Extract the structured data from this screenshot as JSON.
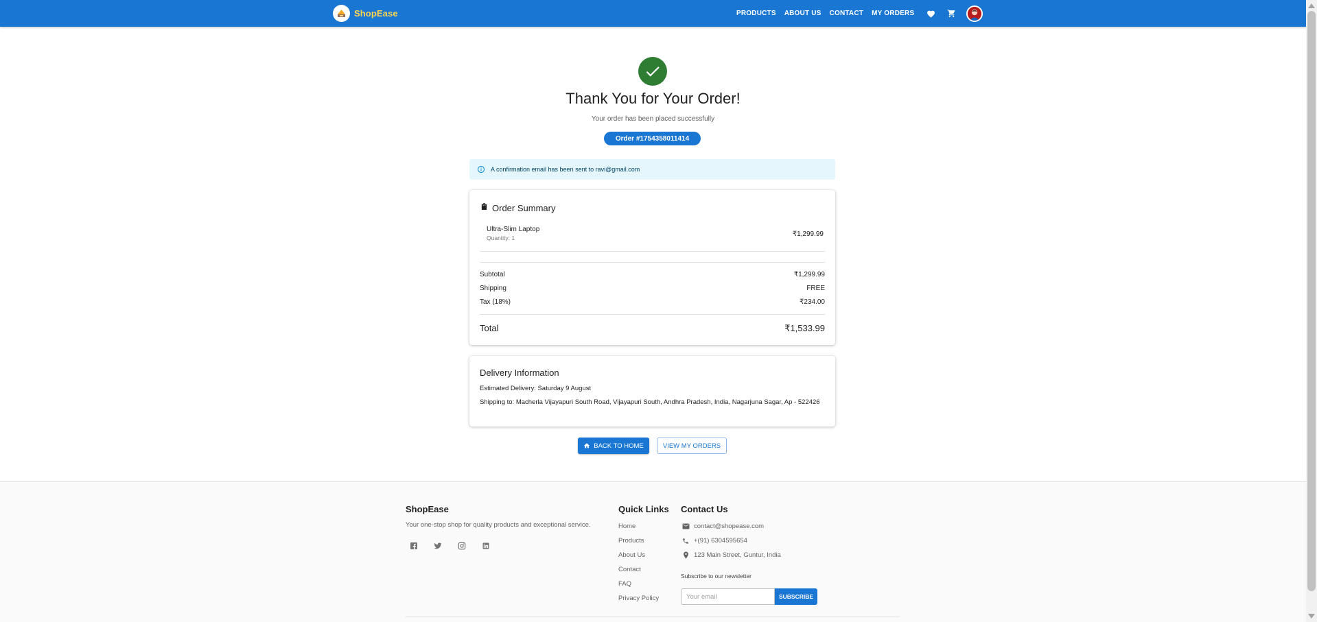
{
  "header": {
    "brand": "ShopEase",
    "nav": [
      "PRODUCTS",
      "ABOUT US",
      "CONTACT",
      "MY ORDERS"
    ],
    "icons": [
      "favorite-icon",
      "cart-icon",
      "account-avatar"
    ]
  },
  "confirmation": {
    "title": "Thank You for Your Order!",
    "subtitle": "Your order has been placed successfully",
    "order_badge": "Order #1754358011414",
    "alert": "A confirmation email has been sent to ravi@gmail.com"
  },
  "summary": {
    "title": "Order Summary",
    "item": {
      "name": "Ultra-Slim Laptop",
      "quantity": "Quantity: 1",
      "price": "₹1,299.99"
    },
    "subtotal_label": "Subtotal",
    "subtotal": "₹1,299.99",
    "shipping_label": "Shipping",
    "shipping": "FREE",
    "tax_label": "Tax (18%)",
    "tax": "₹234.00",
    "total_label": "Total",
    "total": "₹1,533.99"
  },
  "delivery": {
    "title": "Delivery Information",
    "estimated": "Estimated Delivery: Saturday 9 August",
    "shipping_to": "Shipping to: Macherla Vijayapuri South Road, Vijayapuri South, Andhra Pradesh, India, Nagarjuna Sagar, Ap - 522426"
  },
  "actions": {
    "home": "BACK TO HOME",
    "orders": "VIEW MY ORDERS"
  },
  "footer": {
    "brand": "ShopEase",
    "tagline": "Your one-stop shop for quality products and exceptional service.",
    "social": [
      "facebook-icon",
      "twitter-icon",
      "instagram-icon",
      "linkedin-icon"
    ],
    "quick_links_title": "Quick Links",
    "quick_links": [
      "Home",
      "Products",
      "About Us",
      "Contact",
      "FAQ",
      "Privacy Policy"
    ],
    "contact_title": "Contact Us",
    "email": "contact@shopease.com",
    "phone": "+(91) 6304595654",
    "address": "123 Main Street, Guntur, India",
    "newsletter_label": "Subscribe to our newsletter",
    "newsletter_placeholder": "Your email",
    "subscribe": "SUBSCRIBE"
  },
  "colors": {
    "primary": "#1976d2",
    "success": "#2e7d32",
    "brand_text": "#ffd54f",
    "alert_bg": "#e5f6fd"
  }
}
